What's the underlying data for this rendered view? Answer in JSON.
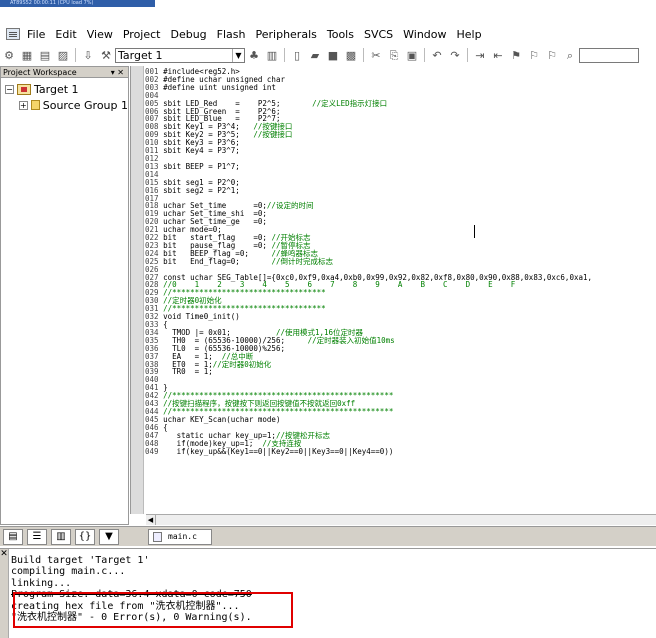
{
  "window": {
    "title_strip": "AT89S52 00:00:11 (CPU load 7%)"
  },
  "menu": [
    "File",
    "Edit",
    "View",
    "Project",
    "Debug",
    "Flash",
    "Peripherals",
    "Tools",
    "SVCS",
    "Window",
    "Help"
  ],
  "toolbar": {
    "target_select": "Target 1"
  },
  "workspace": {
    "title": "Project Workspace",
    "tree": [
      {
        "label": "Target 1",
        "expander": "−",
        "indent": 0
      },
      {
        "label": "Source Group 1",
        "expander": "+",
        "indent": 1
      }
    ]
  },
  "editor": {
    "tab": "main.c",
    "lines": [
      {
        "n": "001",
        "code": "#include<reg52.h>",
        "cmt": ""
      },
      {
        "n": "002",
        "code": "#define uchar unsigned char",
        "cmt": ""
      },
      {
        "n": "003",
        "code": "#define uint unsigned int",
        "cmt": ""
      },
      {
        "n": "004",
        "code": "",
        "cmt": ""
      },
      {
        "n": "005",
        "code": "sbit LED_Red    =    P2^5;       ",
        "cmt": "//定义LED指示灯接口"
      },
      {
        "n": "006",
        "code": "sbit LED_Green  =    P2^6;",
        "cmt": ""
      },
      {
        "n": "007",
        "code": "sbit LED_Blue   =    P2^7;",
        "cmt": ""
      },
      {
        "n": "008",
        "code": "sbit Key1 = P3^4;   ",
        "cmt": "//按键接口"
      },
      {
        "n": "009",
        "code": "sbit Key2 = P3^5;   ",
        "cmt": "//按键接口"
      },
      {
        "n": "010",
        "code": "sbit Key3 = P3^6;",
        "cmt": ""
      },
      {
        "n": "011",
        "code": "sbit Key4 = P3^7;",
        "cmt": ""
      },
      {
        "n": "012",
        "code": "",
        "cmt": ""
      },
      {
        "n": "013",
        "code": "sbit BEEP = P1^7;",
        "cmt": ""
      },
      {
        "n": "014",
        "code": "",
        "cmt": ""
      },
      {
        "n": "015",
        "code": "sbit seg1 = P2^0;",
        "cmt": ""
      },
      {
        "n": "016",
        "code": "sbit seg2 = P2^1;",
        "cmt": ""
      },
      {
        "n": "017",
        "code": "",
        "cmt": ""
      },
      {
        "n": "018",
        "code": "uchar Set_time      =0;",
        "cmt": "//设定的时间"
      },
      {
        "n": "019",
        "code": "uchar Set_time_shi  =0;",
        "cmt": ""
      },
      {
        "n": "020",
        "code": "uchar Set_time_ge   =0;",
        "cmt": ""
      },
      {
        "n": "021",
        "code": "uchar mode=0;",
        "cmt": ""
      },
      {
        "n": "022",
        "code": "bit   start_flag    =0; ",
        "cmt": "//开始标志"
      },
      {
        "n": "023",
        "code": "bit   pause_flag    =0; ",
        "cmt": "//暂停标志"
      },
      {
        "n": "024",
        "code": "bit   BEEP_flag =0;     ",
        "cmt": "//蜂鸣器标志"
      },
      {
        "n": "025",
        "code": "bit   End_flag=0;       ",
        "cmt": "//倒计时完成标志"
      },
      {
        "n": "026",
        "code": "",
        "cmt": ""
      },
      {
        "n": "027",
        "code": "const uchar SEG_Table[]={0xc0,0xf9,0xa4,0xb0,0x99,0x92,0x82,0xf8,0x80,0x90,0x88,0x83,0xc6,0xa1,",
        "cmt": ""
      },
      {
        "n": "028",
        "code": "",
        "cmt": "//0    1    2    3    4    5    6    7    8    9    A    B    C    D    E    F"
      },
      {
        "n": "029",
        "code": "",
        "cmt": "//**********************************"
      },
      {
        "n": "030",
        "code": "",
        "cmt": "//定时器0初始化"
      },
      {
        "n": "031",
        "code": "",
        "cmt": "//**********************************"
      },
      {
        "n": "032",
        "code": "void Time0_init()",
        "cmt": ""
      },
      {
        "n": "033",
        "code": "{",
        "cmt": ""
      },
      {
        "n": "034",
        "code": "  TMOD |= 0x01;          ",
        "cmt": "//使用模式1,16位定时器"
      },
      {
        "n": "035",
        "code": "  TH0  = (65536-10000)/256;     ",
        "cmt": "//定时器装入初始值10ms"
      },
      {
        "n": "036",
        "code": "  TL0  = (65536-10000)%256;",
        "cmt": ""
      },
      {
        "n": "037",
        "code": "  EA   = 1;  ",
        "cmt": "//总中断"
      },
      {
        "n": "038",
        "code": "  ET0  = 1;",
        "cmt": "//定时器0初始化"
      },
      {
        "n": "039",
        "code": "  TR0  = 1;",
        "cmt": ""
      },
      {
        "n": "040",
        "code": "",
        "cmt": ""
      },
      {
        "n": "041",
        "code": "}",
        "cmt": ""
      },
      {
        "n": "042",
        "code": "",
        "cmt": "//*************************************************"
      },
      {
        "n": "043",
        "code": "",
        "cmt": "//按键扫描程序，按键按下则返回按键值不按就返回0xff"
      },
      {
        "n": "044",
        "code": "",
        "cmt": "//*************************************************"
      },
      {
        "n": "045",
        "code": "uchar KEY_Scan(uchar mode)",
        "cmt": ""
      },
      {
        "n": "046",
        "code": "{",
        "cmt": ""
      },
      {
        "n": "047",
        "code": "   static uchar key_up=1;",
        "cmt": "//按键松开标志"
      },
      {
        "n": "048",
        "code": "   if(mode)key_up=1;  ",
        "cmt": "//支持连按"
      },
      {
        "n": "049",
        "code": "   if(key_up&&(Key1==0||Key2==0||Key3==0||Key4==0))",
        "cmt": ""
      }
    ]
  },
  "output": {
    "lines": [
      "Build target 'Target 1'",
      "compiling main.c...",
      "linking...",
      "Program Size: data=36.4 xdata=0 code=750",
      "creating hex file from \"洗衣机控制器\"...",
      "\"洗衣机控制器\" - 0 Error(s), 0 Warning(s)."
    ]
  },
  "colors": {
    "comment": "#008000",
    "number": "#c000c0",
    "highlight": "#e00000"
  }
}
